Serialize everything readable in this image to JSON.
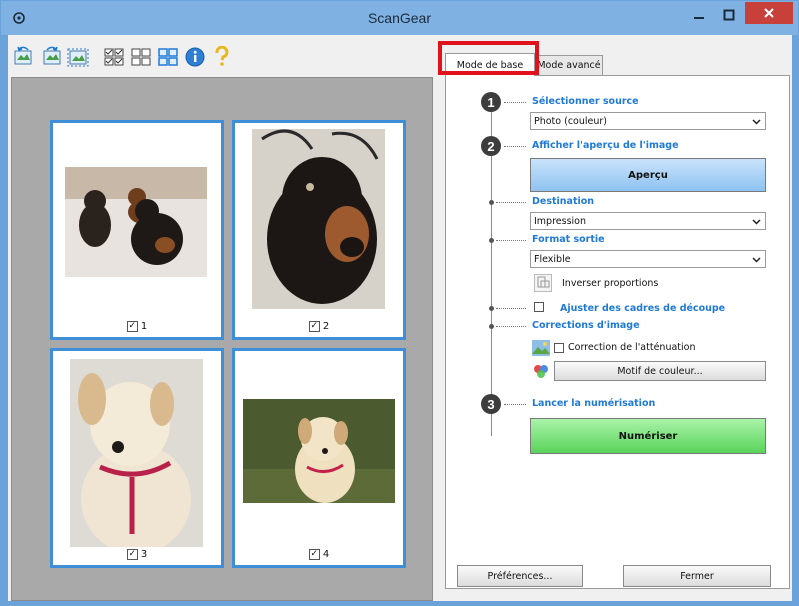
{
  "window": {
    "title": "ScanGear"
  },
  "toolbar": {
    "icons": [
      "rotate-left-icon",
      "rotate-right-icon",
      "auto-crop-icon",
      "select-all-frames-icon",
      "deselect-frames-icon",
      "toggle-view-icon",
      "info-icon",
      "help-icon"
    ]
  },
  "thumbnails": [
    {
      "number": "1",
      "checked": true
    },
    {
      "number": "2",
      "checked": true
    },
    {
      "number": "3",
      "checked": true
    },
    {
      "number": "4",
      "checked": true
    }
  ],
  "tabs": {
    "basic": "Mode de base",
    "advanced": "Mode avancé"
  },
  "steps": {
    "step1": {
      "number": "1",
      "title": "Sélectionner source",
      "value": "Photo (couleur)"
    },
    "step2": {
      "number": "2",
      "title": "Afficher l'aperçu de l'image",
      "button": "Aperçu"
    },
    "destination": {
      "title": "Destination",
      "value": "Impression"
    },
    "output": {
      "title": "Format sortie",
      "value": "Flexible"
    },
    "invert": {
      "label": "Inverser proportions"
    },
    "crop": {
      "label": "Ajuster des cadres de découpe"
    },
    "corrections": {
      "title": "Corrections d'image",
      "fade_label": "Correction de l'atténuation",
      "color_pattern_button": "Motif de couleur..."
    },
    "step3": {
      "number": "3",
      "title": "Lancer la numérisation",
      "button": "Numériser"
    }
  },
  "footer": {
    "preferences": "Préférences...",
    "close": "Fermer"
  },
  "colors": {
    "accent_blue": "#1f7ad6",
    "frame_blue": "#3e8fd8",
    "highlight_red": "#e0121b",
    "scan_green": "#5ad45a"
  }
}
